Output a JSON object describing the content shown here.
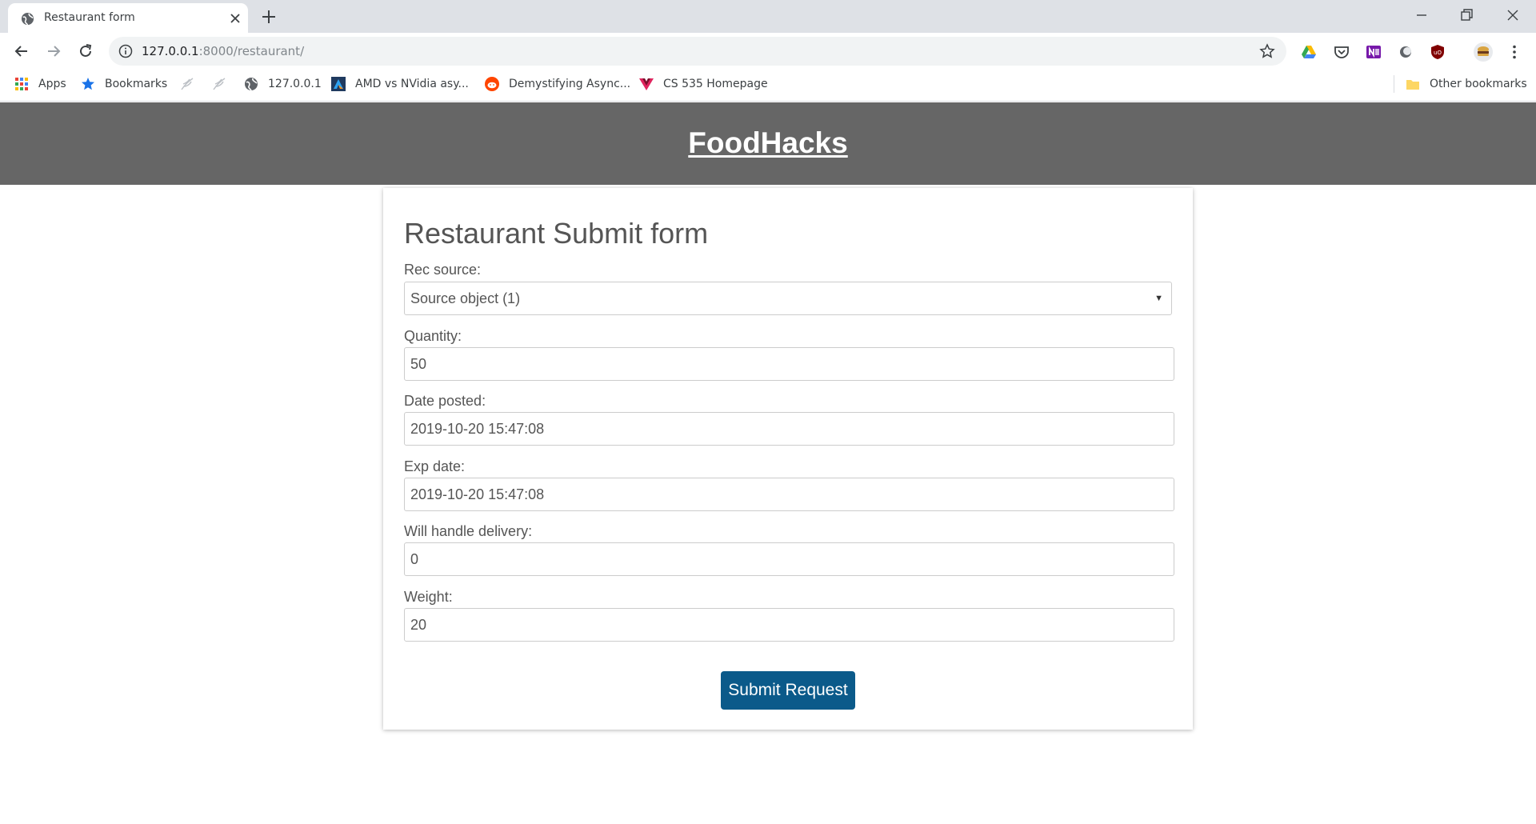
{
  "browser": {
    "tab_title": "Restaurant form",
    "url_host": "127.0.0.1",
    "url_path": ":8000/restaurant/",
    "bookmarks": [
      {
        "label": "Apps",
        "icon": "apps-grid-icon"
      },
      {
        "label": "Bookmarks",
        "icon": "star-icon"
      },
      {
        "label": "",
        "icon": "feather-icon"
      },
      {
        "label": "",
        "icon": "feather-icon"
      },
      {
        "label": "127.0.0.1",
        "icon": "globe-icon"
      },
      {
        "label": "AMD vs NVidia asy...",
        "icon": "amd-icon"
      },
      {
        "label": "Demystifying Async...",
        "icon": "reddit-icon"
      },
      {
        "label": "CS 535 Homepage",
        "icon": "vue-icon"
      }
    ],
    "other_bookmarks": "Other bookmarks"
  },
  "header": {
    "brand": "FoodHacks"
  },
  "form": {
    "title": "Restaurant Submit form",
    "rec_source_label": "Rec source:",
    "rec_source_value": "Source object (1)",
    "quantity_label": "Quantity:",
    "quantity_value": "50",
    "date_posted_label": "Date posted:",
    "date_posted_value": "2019-10-20 15:47:08",
    "exp_date_label": "Exp date:",
    "exp_date_value": "2019-10-20 15:47:08",
    "delivery_label": "Will handle delivery:",
    "delivery_value": "0",
    "weight_label": "Weight:",
    "weight_value": "20",
    "submit_label": "Submit Request"
  },
  "colors": {
    "header_bg": "#666666",
    "submit_bg": "#0b5a8a"
  }
}
